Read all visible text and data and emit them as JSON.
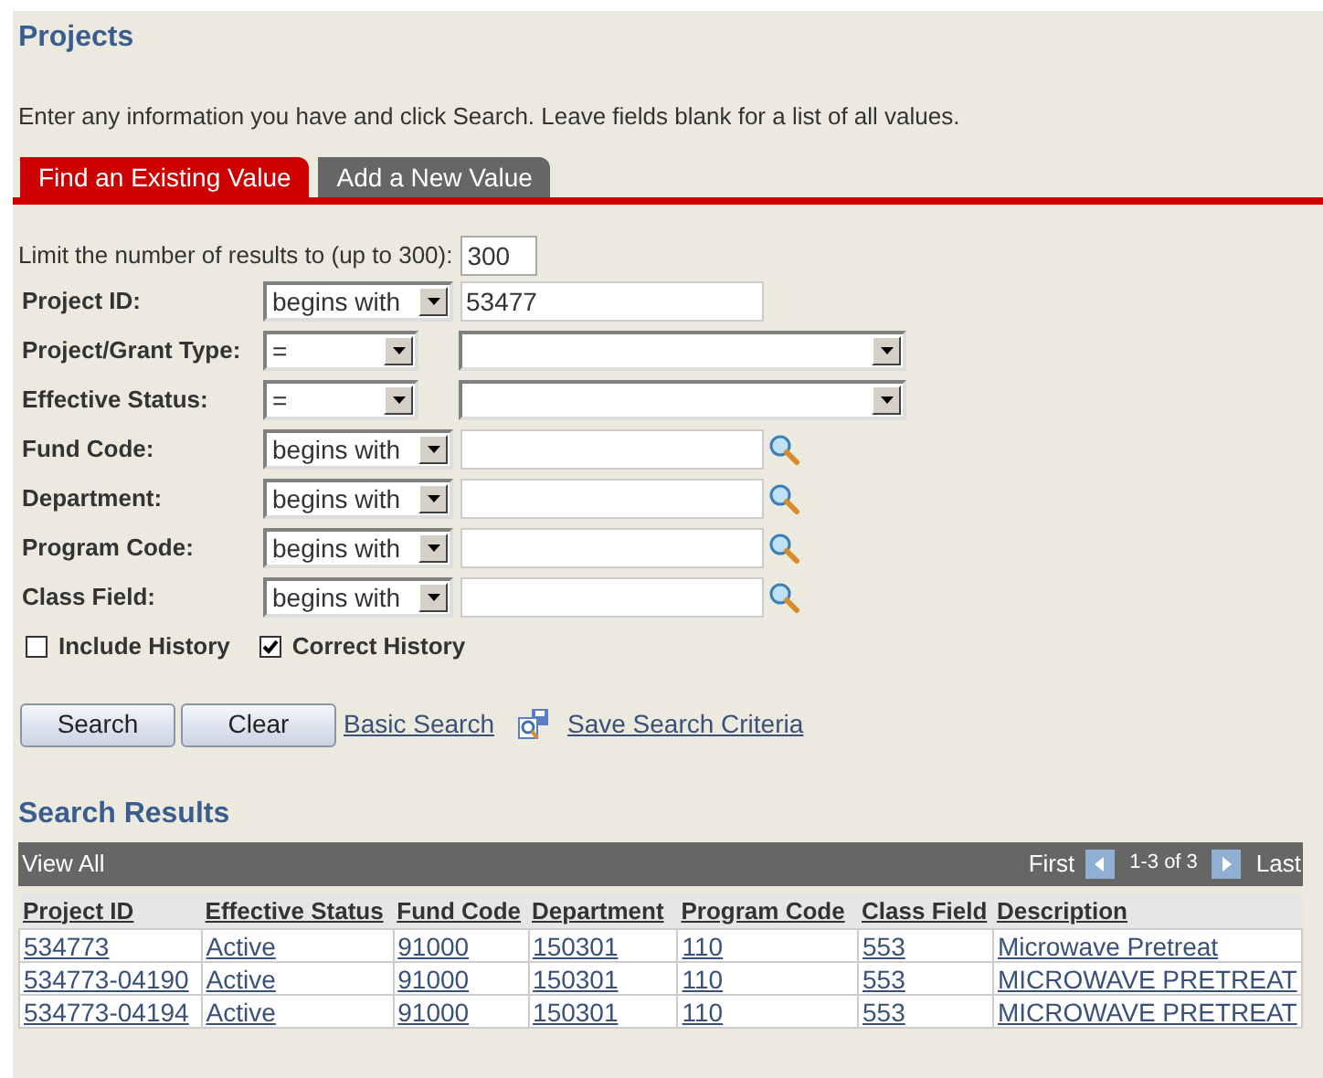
{
  "title": "Projects",
  "instructions": "Enter any information you have and click Search. Leave fields blank for a list of all values.",
  "tabs": [
    {
      "label": "Find an Existing Value",
      "selected": true
    },
    {
      "label": "Add a New Value",
      "selected": false
    }
  ],
  "limit": {
    "label": "Limit the number of results to (up to 300):",
    "value": "300"
  },
  "criteria": [
    {
      "kind": "text",
      "label": "Project ID:",
      "operator": "begins with",
      "value": "53477"
    },
    {
      "kind": "dropdown",
      "label": "Project/Grant Type:",
      "operator": "="
    },
    {
      "kind": "dropdown",
      "label": "Effective Status:",
      "operator": "="
    },
    {
      "kind": "lookup",
      "label": "Fund Code:",
      "operator": "begins with"
    },
    {
      "kind": "lookup",
      "label": "Department:",
      "operator": "begins with"
    },
    {
      "kind": "lookup",
      "label": "Program Code:",
      "operator": "begins with"
    },
    {
      "kind": "lookup",
      "label": "Class Field:",
      "operator": "begins with"
    }
  ],
  "checkboxes": [
    {
      "label": "Include History",
      "checked": false
    },
    {
      "label": "Correct History",
      "checked": true
    }
  ],
  "buttons": [
    "Search",
    "Clear"
  ],
  "links": [
    "Basic Search",
    "Save Search Criteria"
  ],
  "results": {
    "title": "Search Results",
    "view_all": "View All",
    "first": "First",
    "range": "1-3 of 3",
    "last": "Last",
    "columns": [
      "Project ID",
      "Effective Status",
      "Fund Code",
      "Department",
      "Program Code",
      "Class Field",
      "Description"
    ],
    "rows": [
      [
        "534773",
        "Active",
        "91000",
        "150301",
        "110",
        "553",
        "Microwave Pretreat"
      ],
      [
        "534773-04190",
        "Active",
        "91000",
        "150301",
        "110",
        "553",
        "MICROWAVE PRETREAT"
      ],
      [
        "534773-04194",
        "Active",
        "91000",
        "150301",
        "110",
        "553",
        "MICROWAVE PRETREAT"
      ]
    ]
  }
}
